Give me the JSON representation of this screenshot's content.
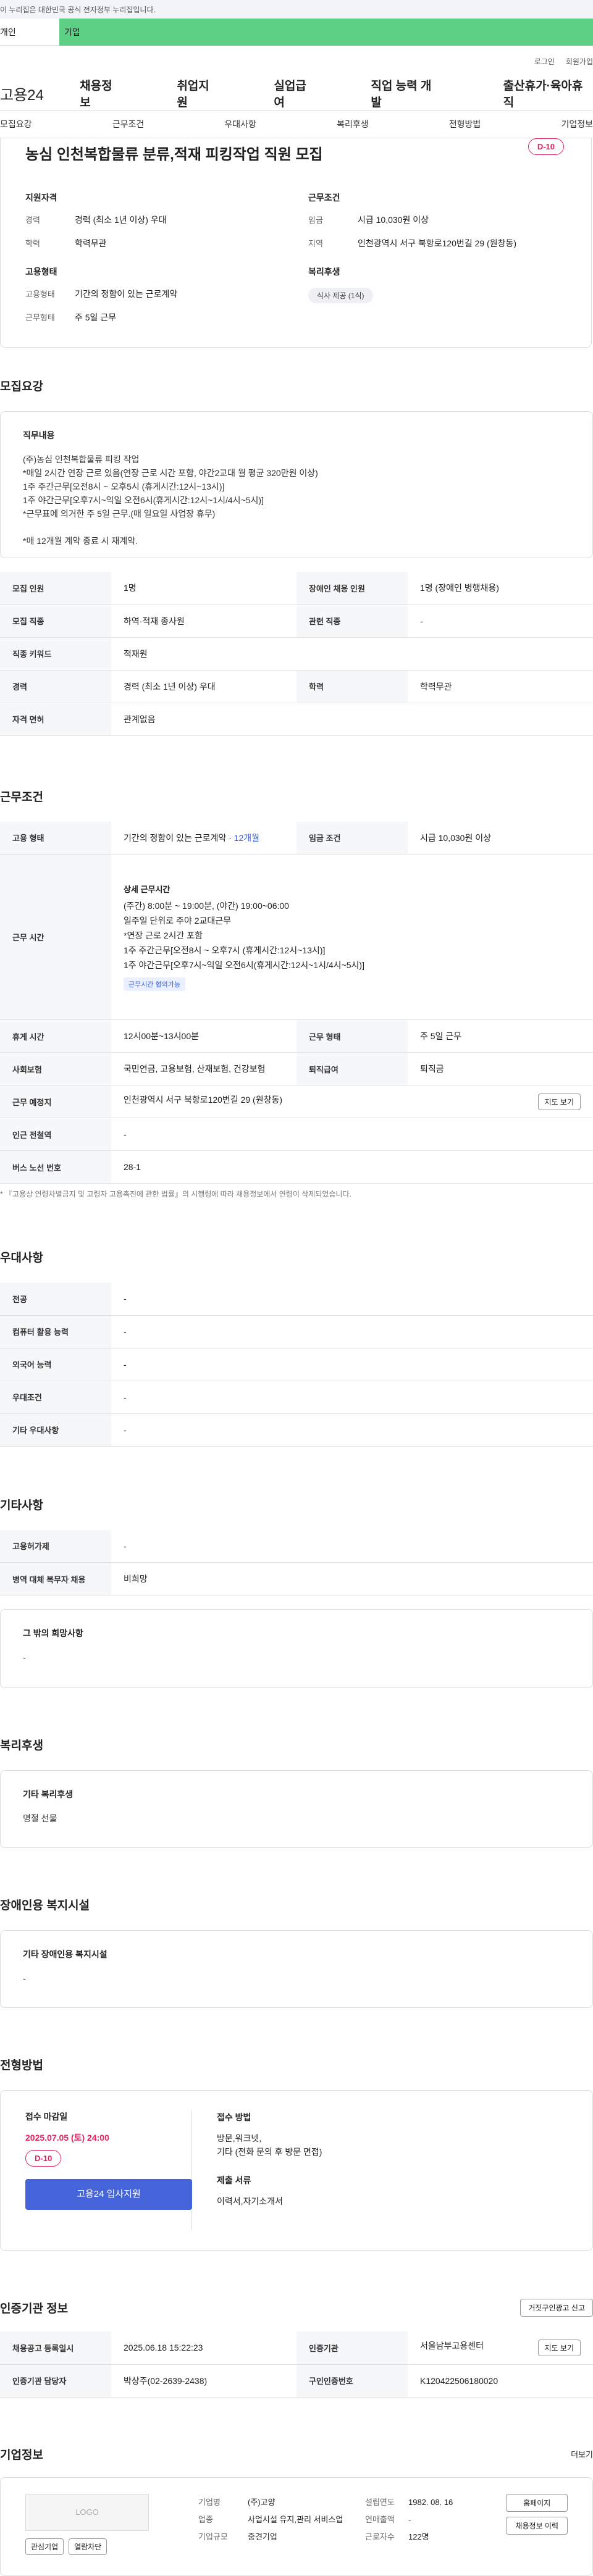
{
  "gov_banner": "이 누리집은 대한민국 공식 전자정부 누리집입니다.",
  "top_tabs": [
    "개인",
    "기업"
  ],
  "util": [
    "로그인",
    "회원가입"
  ],
  "gnb": {
    "logo": "고용24",
    "menu": [
      "채용정보",
      "취업지원",
      "실업급여",
      "직업 능력 개발",
      "출산휴가·육아휴직"
    ]
  },
  "anchor": [
    "모집요강",
    "근무조건",
    "우대사항",
    "복리후생",
    "전형방법",
    "기업정보"
  ],
  "summary": {
    "title": "농심 인천복합물류 분류,적재 피킹작업 직원 모집",
    "dday": "D-10",
    "qual_h": "지원자격",
    "cond_h": "근무조건",
    "emp_h": "고용형태",
    "welfare_h": "복리후생",
    "qual": [
      [
        "경력",
        "경력 (최소 1년 이상) 우대"
      ],
      [
        "학력",
        "학력무관"
      ]
    ],
    "cond": [
      [
        "임금",
        "시급 10,030원 이상"
      ],
      [
        "지역",
        "인천광역시 서구 북항로120번길 29 (원창동)"
      ]
    ],
    "emp": [
      [
        "고용형태",
        "기간의 정함이 있는 근로계약"
      ],
      [
        "근무형태",
        "주 5일 근무"
      ]
    ],
    "welfare": "식사 제공 (1식)"
  },
  "recruit": {
    "heading": "모집요강",
    "box_h": "직무내용",
    "desc": "(주)농심 인천복합물류 피킹 작업\n*매일 2시간 연장 근로 있음(연장 근로 시간 포함, 야간2교대 월 평균 320만원 이상)\n  1주 주간근무[오전8시 ~ 오후5시 (휴게시간:12시~13시)]\n  1주 야간근무[오후7시~익일 오전6시(휴게시간:12시~1시/4시~5시)]\n*근무표에 의거한 주 5일 근무.(매 일요일 사업장 휴무)\n\n*매 12개월 계약 종료 시 재계약.",
    "rows": [
      [
        "모집 인원",
        "1명",
        "장애인 채용 인원",
        "1명 (장애인 병행채용)"
      ],
      [
        "모집 직종",
        "하역·적재 종사원",
        "관련 직종",
        "-"
      ],
      [
        "직종 키워드",
        "적재원",
        "",
        ""
      ],
      [
        "경력",
        "경력 (최소 1년 이상) 우대",
        "학력",
        "학력무관"
      ],
      [
        "자격 면허",
        "관계없음",
        "",
        ""
      ]
    ]
  },
  "work": {
    "heading": "근무조건",
    "emp": "기간의 정함이 있는 근로계약 · ",
    "months": "12개월",
    "pay_h": "임금 조건",
    "pay": "시급 10,030원 이상",
    "time_h": "근무 시간",
    "time_title": "상세 근무시간",
    "time_desc": "(주간) 8:00분 ~ 19:00분, (야간) 19:00~06:00\n일주일 단위로 주야 2교대근무\n*연장 근로 2시간 포함\n 1주 주간근무[오전8시 ~ 오후7시 (휴게시간:12시~13시)]\n 1주 야간근무[오후7시~익일 오전6시(휴게시간:12시~1시/4시~5시)]",
    "time_tag": "근무시간 협의가능",
    "rows": [
      [
        "휴게 시간",
        "12시00분~13시00분",
        "근무 형태",
        "주 5일 근무"
      ],
      [
        "사회보험",
        "국민연금, 고용보험, 산재보험, 건강보험",
        "퇴직급여",
        "퇴직금"
      ]
    ],
    "place_h": "근무 예정지",
    "place": "인천광역시 서구 북항로120번길 29 (원창동)",
    "map": "지도 보기",
    "subway_h": "인근 전철역",
    "subway": "-",
    "bus_h": "버스 노선 번호",
    "bus": "28-1",
    "note": "* 『고용상 연령차별금지 및 고령자 고용촉진에 관한 법률』의 시행령에 따라 채용정보에서 연령이 삭제되었습니다.",
    "emp_h": "고용 형태"
  },
  "pref": {
    "heading": "우대사항",
    "rows": [
      [
        "전공",
        "-"
      ],
      [
        "컴퓨터 활용 능력",
        "-"
      ],
      [
        "외국어 능력",
        "-"
      ],
      [
        "우대조건",
        "-"
      ],
      [
        "기타 우대사항",
        "-"
      ]
    ]
  },
  "etc": {
    "heading": "기타사항",
    "rows": [
      [
        "고용허가제",
        "-"
      ],
      [
        "병역 대체 복무자 채용",
        "비희망"
      ]
    ],
    "box_h": "그 밖의 희망사항",
    "box_v": "-"
  },
  "welfare": {
    "heading": "복리후생",
    "box_h": "기타 복리후생",
    "box_v": "명절 선물"
  },
  "disab": {
    "heading": "장애인용 복지시설",
    "box_h": "기타 장애인용 복지시설",
    "box_v": "-"
  },
  "apply": {
    "heading": "전형방법",
    "deadline_h": "접수 마감일",
    "deadline": "2025.07.05 (토) 24:00",
    "dday": "D-10",
    "btn": "고용24 입사지원",
    "method_h": "접수 방법",
    "method": "방문,워크넷,\n기타 (전화 문의 후 방문 면접)",
    "docs_h": "제출 서류",
    "docs": "이력서,자기소개서"
  },
  "agency": {
    "heading": "인증기관 정보",
    "report": "거짓구인광고 신고",
    "rows": [
      [
        "채용공고 등록일시",
        "2025.06.18 15:22:23",
        "인증기관",
        "서울남부고용센터"
      ],
      [
        "인증기관 담당자",
        "박상주(02-2639-2438)",
        "구인인증번호",
        "K120422506180020"
      ]
    ],
    "map": "지도 보기"
  },
  "company": {
    "heading": "기업정보",
    "more": "더보기",
    "logo": "LOGO",
    "fav": "관심기업",
    "block": "열람차단",
    "name_h": "기업명",
    "name": "(주)고양",
    "biz_h": "업종",
    "biz": "사업시설 유지,관리 서비스업",
    "size_h": "기업규모",
    "size": "중견기업",
    "year_h": "설립연도",
    "year": "1982. 08. 16",
    "sales_h": "연매출액",
    "sales": "-",
    "emp_h": "근로자수",
    "emp": "122명",
    "home": "홈페이지",
    "info": "채용정보 이력"
  }
}
